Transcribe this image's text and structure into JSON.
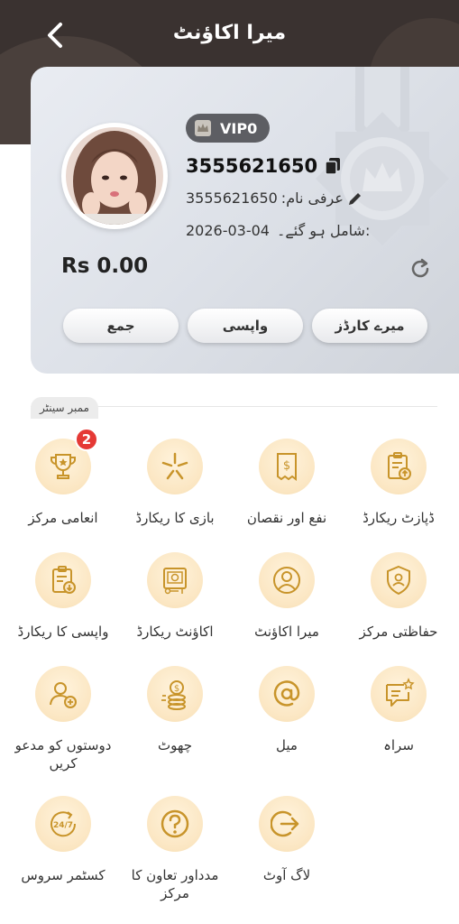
{
  "header": {
    "title": "میرا اکاؤنٹ"
  },
  "profile": {
    "vip_level": "VIP0",
    "user_id": "3555621650",
    "nickname_label": "عرفی نام:",
    "nickname": "3555621650",
    "joined_label": ":شامل ہو گئے۔",
    "joined_date": "2026-03-04",
    "balance": "Rs 0.00"
  },
  "card_buttons": {
    "deposit": "جمع",
    "withdraw": "واپسی",
    "my_cards": "میرے کارڈز"
  },
  "member_center": {
    "title": "ممبر سینٹر",
    "items": [
      {
        "label": "انعامی مرکز",
        "icon": "trophy-icon",
        "badge": "2"
      },
      {
        "label": "بازی کا ریکارڈ",
        "icon": "star-burst-icon"
      },
      {
        "label": "نفع اور نقصان",
        "icon": "receipt-dollar-icon"
      },
      {
        "label": "ڈپازٹ ریکارڈ",
        "icon": "clipboard-upload-icon"
      },
      {
        "label": "واپسی کا ریکارڈ",
        "icon": "clipboard-download-icon"
      },
      {
        "label": "اکاؤنٹ ریکارڈ",
        "icon": "account-record-icon"
      },
      {
        "label": "میرا اکاؤنٹ",
        "icon": "user-circle-icon"
      },
      {
        "label": "حفاظتی مرکز",
        "icon": "shield-user-icon"
      },
      {
        "label": "دوستوں کو مدعو کریں",
        "icon": "invite-user-icon"
      },
      {
        "label": "چھوٹ",
        "icon": "coins-icon"
      },
      {
        "label": "میل",
        "icon": "at-sign-icon"
      },
      {
        "label": "سراہ",
        "icon": "chat-star-icon"
      },
      {
        "label": "کسٹمر سروس",
        "icon": "support-24-7-icon"
      },
      {
        "label": "مدداور تعاون کا مرکز",
        "icon": "question-circle-icon"
      },
      {
        "label": "لاگ آوٹ",
        "icon": "logout-icon"
      }
    ]
  },
  "colors": {
    "icon_bg": "#fbe6c2",
    "icon_stroke": "#c8942a",
    "header_bg": "#3a3230",
    "badge_red": "#e53935"
  }
}
